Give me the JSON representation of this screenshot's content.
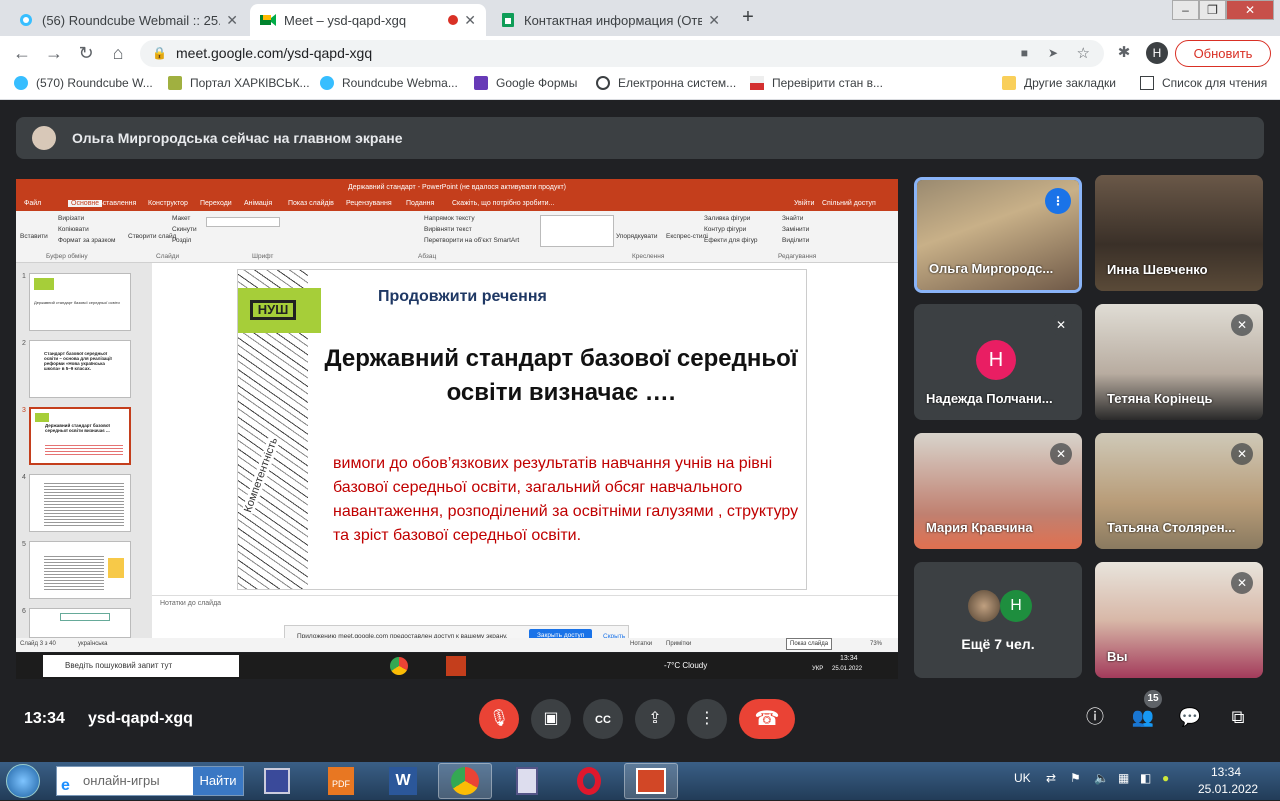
{
  "browser": {
    "tabs": [
      {
        "title": "(56) Roundcube Webmail :: 25.01"
      },
      {
        "title": "Meet – ysd-qapd-xgq"
      },
      {
        "title": "Контактная информация (Ответ"
      }
    ],
    "url": "meet.google.com/ysd-qapd-xgq",
    "update_label": "Обновить",
    "avatar_letter": "H",
    "bookmarks": [
      "(570) Roundcube W...",
      "Портал ХАРКІВСЬК...",
      "Roundcube Webma...",
      "Google Формы",
      "Електронна систем...",
      "Перевірити стан в..."
    ],
    "other_bookmarks": "Другие закладки",
    "reading_list": "Список для чтения"
  },
  "meet": {
    "banner": "Ольга Миргородська сейчас на главном экране",
    "time": "13:34",
    "meeting_code": "ysd-qapd-xgq",
    "people_count": "15",
    "participants": [
      {
        "name": "Ольга Миргородс...",
        "speaking": true
      },
      {
        "name": "Инна Шевченко"
      },
      {
        "name": "Надежда Полчани...",
        "initial": "Н"
      },
      {
        "name": "Тетяна Корінець"
      },
      {
        "name": "Мария Кравчина"
      },
      {
        "name": "Татьяна Столярен..."
      },
      {
        "name": "Ещё 7 чел.",
        "initial": "Н"
      },
      {
        "name": "Вы"
      }
    ]
  },
  "ppt": {
    "window_title": "Державний стандарт - PowerPoint (не вдалося активувати продукт)",
    "ribbon_tabs": [
      "Файл",
      "Основне",
      "Вставлення",
      "Конструктор",
      "Переходи",
      "Анімація",
      "Показ слайдів",
      "Рецензування",
      "Подання",
      "Скажіть, що потрібно зробити..."
    ],
    "signin": "Увійти",
    "share": "Спільний доступ",
    "ribbon_groups": [
      "Буфер обміну",
      "Слайди",
      "Шрифт",
      "Абзац",
      "Креслення",
      "Редагування"
    ],
    "ribbon_cmds": [
      "Вирізати",
      "Копіювати",
      "Формат за зразком",
      "Вставити",
      "Створити слайд",
      "Макет",
      "Скинути",
      "Розділ",
      "Напрямок тексту",
      "Вирівняти текст",
      "Перетворити на об'єкт SmartArt",
      "Упорядкувати",
      "Експрес-стилі",
      "Заливка фігури",
      "Контур фігури",
      "Ефекти для фігур",
      "Знайти",
      "Замінити",
      "Виділити"
    ],
    "slide": {
      "subtitle": "Продовжити речення",
      "title": "Державний стандарт базової середньої освіти  визначає ….",
      "body": "вимоги до обов’язкових результатів навчання учнів  на рівні базової середньої освіти,  загальний обсяг навчального навантаження, розподілений за освітніми галузями , структуру та зріст базової середньої освіти.",
      "logo_text": "НУШ",
      "deco_text": "Компетентність"
    },
    "thumbs": [
      {
        "num": "1",
        "text": "Державний стандарт базової середньої освіти"
      },
      {
        "num": "2",
        "text": "Стандарт базової середньої освіти – основа для реалізації реформи «Нова українська школа» в 5–9 класах."
      },
      {
        "num": "3",
        "text": "Державний стандарт базової середньої освіти визначає ..."
      },
      {
        "num": "4",
        "text": ""
      },
      {
        "num": "5",
        "text": ""
      },
      {
        "num": "6",
        "text": ""
      }
    ],
    "notes_placeholder": "Нотатки до слайда",
    "status_slide": "Слайд 3 з 40",
    "status_lang": "українська",
    "status_notes": "Нотатки",
    "status_comments": "Примітки",
    "zoom": "73%",
    "tooltip": "Показ слайда",
    "share_msg": "Приложению meet.google.com предоставлен доступ к вашему экрану.",
    "share_stop": "Закрыть доступ",
    "share_hide": "Скрыть",
    "inner_search": "Введіть пошуковий запит тут",
    "weather": "-7°C  Cloudy",
    "inner_lang": "УКР",
    "inner_time": "13:34",
    "inner_date": "25.01.2022"
  },
  "taskbar": {
    "search_value": "онлайн-игры",
    "search_button": "Найти",
    "lang": "UK",
    "time": "13:34",
    "date": "25.01.2022"
  }
}
